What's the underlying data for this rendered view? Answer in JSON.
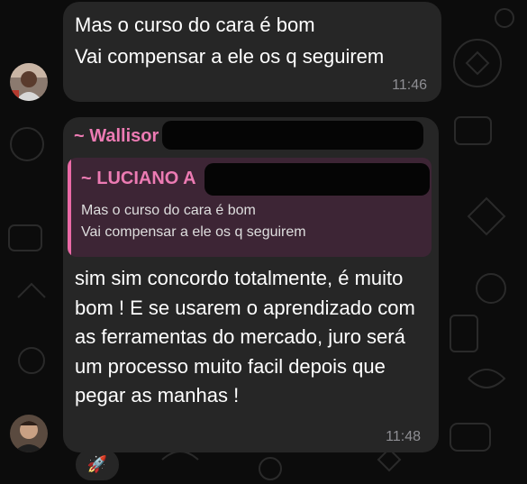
{
  "messages": [
    {
      "lines": [
        "Mas o curso do cara é bom",
        "Vai compensar a ele os q seguirem"
      ],
      "time": "11:46"
    },
    {
      "sender": "~ Wallisor",
      "reply": {
        "name": "~ LUCIANO A",
        "lines": [
          "Mas o curso do cara é bom",
          "Vai compensar a ele os q seguirem"
        ]
      },
      "text": "sim sim concordo totalmente, é muito bom ! E se usarem o aprendizado com as ferramentas do mercado, juro será um processo muito facil depois que pegar as manhas !",
      "time": "11:48",
      "reaction": "🚀"
    }
  ],
  "colors": {
    "background": "#0c0c0c",
    "bubble": "#262626",
    "accent_pink": "#ec7bb3",
    "reply_background": "#3d2535",
    "timestamp": "#8e8e93"
  }
}
